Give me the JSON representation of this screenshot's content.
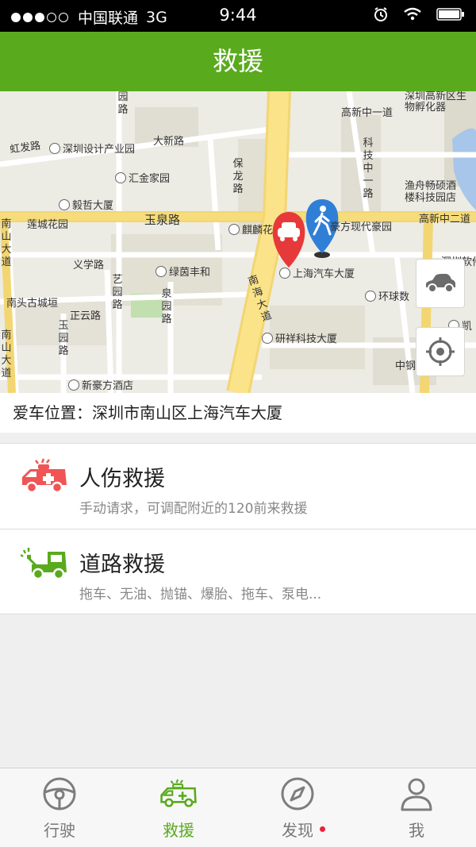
{
  "status_bar": {
    "carrier": "中国联通",
    "network": "3G",
    "time": "9:44"
  },
  "nav": {
    "title": "救援"
  },
  "map": {
    "labels": {
      "hongfa_rd": "虹发路",
      "shenzhen_design": "深圳设计产业园",
      "daxin_rd": "大新路",
      "huijin_home": "汇金家园",
      "yizhe": "毅哲大厦",
      "liancheng": "莲城花园",
      "yuquan_rd": "玉泉路",
      "qilin": "麒麟花",
      "haofang": "豪方现代豪园",
      "gaoxin_1": "高新中一道",
      "gaoxin_2": "高新中二道",
      "high_tech_incubator": "深圳高新区生物孵化器",
      "yuzhou": "渔舟畅硕酒楼科技园店",
      "keji_1": "科技中一路",
      "baolong": "保龙路",
      "yuan": "园路",
      "yixue": "义学路",
      "lvyin": "绿茵丰和",
      "nanhai_rd": "南海大道",
      "shanghai_auto": "上海汽车大厦",
      "huanqiu": "环球数",
      "shenzhen_soft": "深圳软件",
      "nantou": "南头古城垣",
      "yiyuan": "艺园路",
      "quanyuan": "泉园路",
      "zhengyun": "正云路",
      "yuyuan": "玉园路",
      "yanxiang": "研祥科技大厦",
      "zhonggang": "中钢",
      "kai": "凯",
      "xinhaofang_hotel": "新豪方酒店",
      "nanshan_rd": "南山大道",
      "nanshan_left": "南山大道"
    },
    "car_button_icon": "car-icon",
    "locate_button_icon": "crosshair-icon"
  },
  "location": {
    "text": "爱车位置：深圳市南山区上海汽车大厦"
  },
  "services": [
    {
      "title": "人伤救援",
      "desc": "手动请求，可调配附近的120前来救援",
      "icon": "ambulance-icon"
    },
    {
      "title": "道路救援",
      "desc": "拖车、无油、抛锚、爆胎、拖车、泵电...",
      "icon": "tow-truck-icon"
    }
  ],
  "tabs": [
    {
      "label": "行驶",
      "icon": "steering-wheel-icon"
    },
    {
      "label": "救援",
      "icon": "ambulance-icon"
    },
    {
      "label": "发现",
      "icon": "compass-icon"
    },
    {
      "label": "我",
      "icon": "user-icon"
    }
  ],
  "colors": {
    "brand_green": "#5aaa1e",
    "alert_red": "#f05454",
    "badge_red": "#e8213a"
  }
}
